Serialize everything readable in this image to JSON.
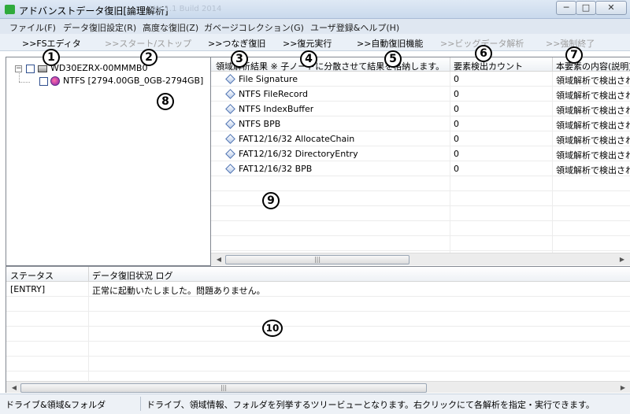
{
  "window": {
    "title": "アドバンストデータ復旧[論理解析]",
    "title_extra": "Ver.1.1  Build 2014",
    "minimize_glyph": "─",
    "maximize_glyph": "□",
    "close_glyph": "✕"
  },
  "menu": [
    "ファイル(F)",
    "データ復旧設定(R)",
    "高度な復旧(Z)",
    "ガベージコレクション(G)",
    "ユーザ登録&ヘルプ(H)"
  ],
  "toolbar": [
    {
      "label": ">>FSエディタ",
      "enabled": true
    },
    {
      "label": ">>スタート/ストップ",
      "enabled": false
    },
    {
      "label": ">>つなぎ復旧",
      "enabled": true
    },
    {
      "label": ">>復元実行",
      "enabled": true
    },
    {
      "label": ">>自動復旧機能",
      "enabled": true
    },
    {
      "label": ">>ビッグデータ解析",
      "enabled": false
    },
    {
      "label": ">>強制終了",
      "enabled": false
    }
  ],
  "callouts": [
    "1",
    "2",
    "3",
    "4",
    "5",
    "6",
    "7",
    "8",
    "9",
    "10"
  ],
  "tree": {
    "expander_glyph": "−",
    "disk_label": "WD30EZRX-00MMMB0",
    "volume_label": "NTFS [2794.00GB_0GB-2794GB]"
  },
  "list": {
    "columns": [
      "領域解析結果 ※ 子ノードに分散させて結果を格納します。",
      "要素検出カウント",
      "本要素の内容(説明)"
    ],
    "rows": [
      {
        "name": "File Signature",
        "count": "0",
        "desc": "領域解析で検出された"
      },
      {
        "name": "NTFS FileRecord",
        "count": "0",
        "desc": "領域解析で検出された"
      },
      {
        "name": "NTFS IndexBuffer",
        "count": "0",
        "desc": "領域解析で検出された"
      },
      {
        "name": "NTFS BPB",
        "count": "0",
        "desc": "領域解析で検出された"
      },
      {
        "name": "FAT12/16/32 AllocateChain",
        "count": "0",
        "desc": "領域解析で検出された"
      },
      {
        "name": "FAT12/16/32 DirectoryEntry",
        "count": "0",
        "desc": "領域解析で検出された"
      },
      {
        "name": "FAT12/16/32 BPB",
        "count": "0",
        "desc": "領域解析で検出された"
      }
    ]
  },
  "log": {
    "columns": [
      "ステータス",
      "データ復旧状況 ログ"
    ],
    "rows": [
      {
        "status": "[ENTRY]",
        "message": "正常に起動いたしました。問題ありません。"
      }
    ]
  },
  "scroll": {
    "left_glyph": "◀",
    "right_glyph": "▶",
    "grip_glyph": "|||"
  },
  "status": {
    "left": "ドライブ&領域&フォルダ",
    "right": "ドライブ、領域情報、フォルダを列挙するツリービューとなります。右クリックにて各解析を指定・実行できます。"
  }
}
